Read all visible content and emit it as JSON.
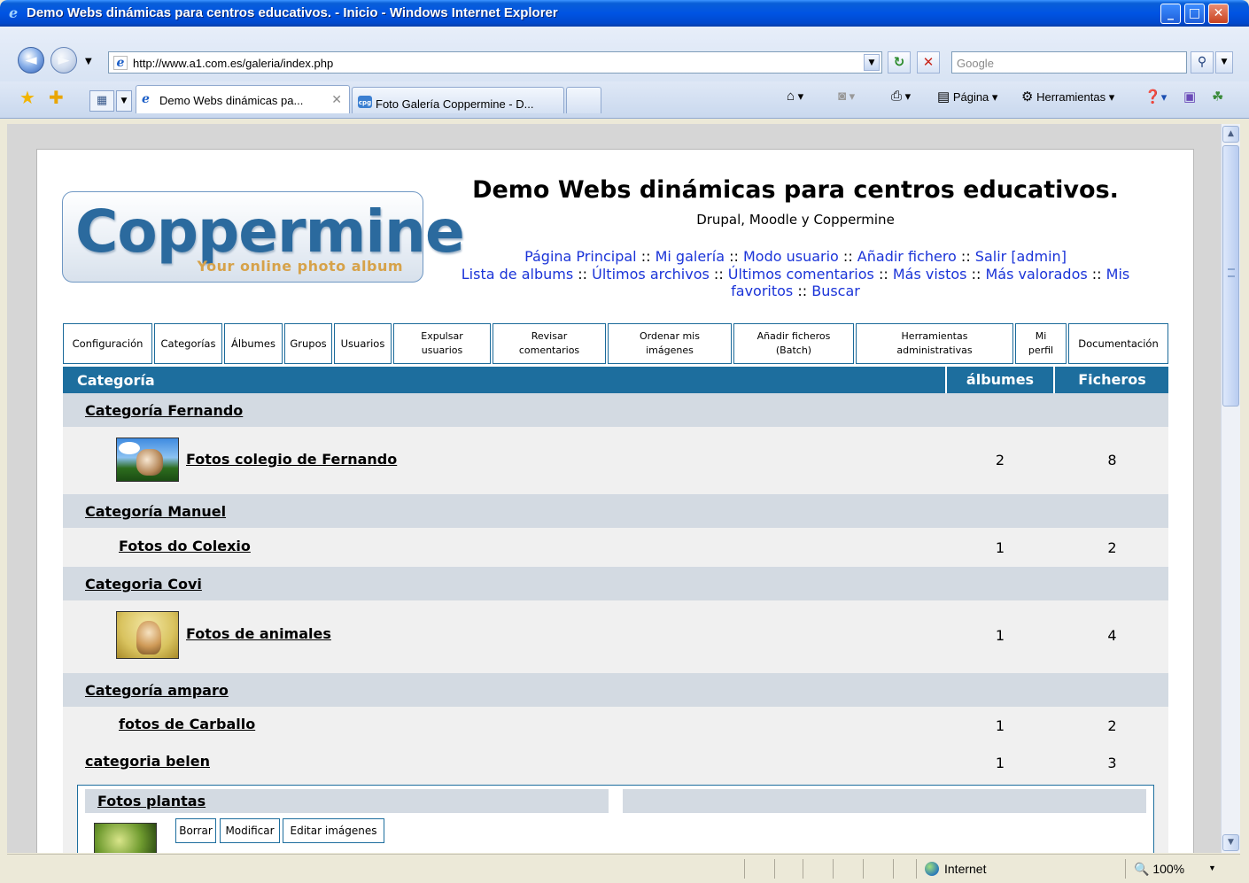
{
  "window": {
    "title": "Demo Webs dinámicas para centros educativos. - Inicio - Windows Internet Explorer",
    "minimize": "_",
    "maximize": "□",
    "close": "✕"
  },
  "address": {
    "url": "http://www.a1.com.es/galeria/index.php"
  },
  "search": {
    "placeholder": "Google"
  },
  "tabs": [
    {
      "label": "Demo Webs dinámicas pa...",
      "active": true
    },
    {
      "label": "Foto Galería Coppermine - D...",
      "active": false
    }
  ],
  "commandbar": {
    "page": "Página",
    "tools": "Herramientas"
  },
  "logo": {
    "title": "Coppermine",
    "subtitle": "Your online photo album"
  },
  "site": {
    "title": "Demo Webs dinámicas para centros educativos.",
    "subtitle": "Drupal, Moodle y Coppermine"
  },
  "topmenu": {
    "line1": [
      "Página Principal",
      "Mi galería",
      "Modo usuario",
      "Añadir fichero",
      "Salir [admin]"
    ],
    "line2": [
      "Lista de albums",
      "Últimos archivos",
      "Últimos comentarios",
      "Más vistos",
      "Más valorados"
    ],
    "mis": "Mis",
    "favoritos": "favoritos",
    "buscar": "Buscar",
    "separator": "::"
  },
  "adminmenu": [
    {
      "line1": "Configuración",
      "line2": ""
    },
    {
      "line1": "Categorías",
      "line2": ""
    },
    {
      "line1": "Álbumes",
      "line2": ""
    },
    {
      "line1": "Grupos",
      "line2": ""
    },
    {
      "line1": "Usuarios",
      "line2": ""
    },
    {
      "line1": "Expulsar",
      "line2": "usuarios"
    },
    {
      "line1": "Revisar",
      "line2": "comentarios"
    },
    {
      "line1": "Ordenar mis",
      "line2": "imágenes"
    },
    {
      "line1": "Añadir ficheros",
      "line2": "(Batch)"
    },
    {
      "line1": "Herramientas",
      "line2": "administrativas"
    },
    {
      "line1": "Mi",
      "line2": "perfil"
    },
    {
      "line1": "Documentación",
      "line2": ""
    }
  ],
  "table": {
    "headers": {
      "category": "Categoría",
      "albums": "álbumes",
      "files": "Ficheros"
    },
    "rows": [
      {
        "type": "category",
        "name": "Categoría Fernando"
      },
      {
        "type": "album",
        "name": "Fotos colegio de Fernando",
        "albums": "2",
        "files": "8",
        "thumb": "cow-photo"
      },
      {
        "type": "category",
        "name": "Categoría Manuel"
      },
      {
        "type": "album",
        "name": "Fotos do Colexio",
        "albums": "1",
        "files": "2"
      },
      {
        "type": "category",
        "name": "Categoria Covi"
      },
      {
        "type": "album",
        "name": "Fotos de animales",
        "albums": "1",
        "files": "4",
        "thumb": "kitten-photo"
      },
      {
        "type": "category",
        "name": "Categoría amparo"
      },
      {
        "type": "album",
        "name": "fotos de Carballo",
        "albums": "1",
        "files": "2"
      },
      {
        "type": "plain",
        "name": "categoria belen",
        "albums": "1",
        "files": "3"
      }
    ],
    "subalbum": {
      "name": "Fotos plantas",
      "buttons": [
        "Borrar",
        "Modificar",
        "Editar imágenes"
      ]
    }
  },
  "status": {
    "zone": "Internet",
    "zoom": "100%"
  },
  "colors": {
    "header": "#1d6e9e",
    "category_row": "#d3dae2",
    "link": "#1b34d8"
  }
}
